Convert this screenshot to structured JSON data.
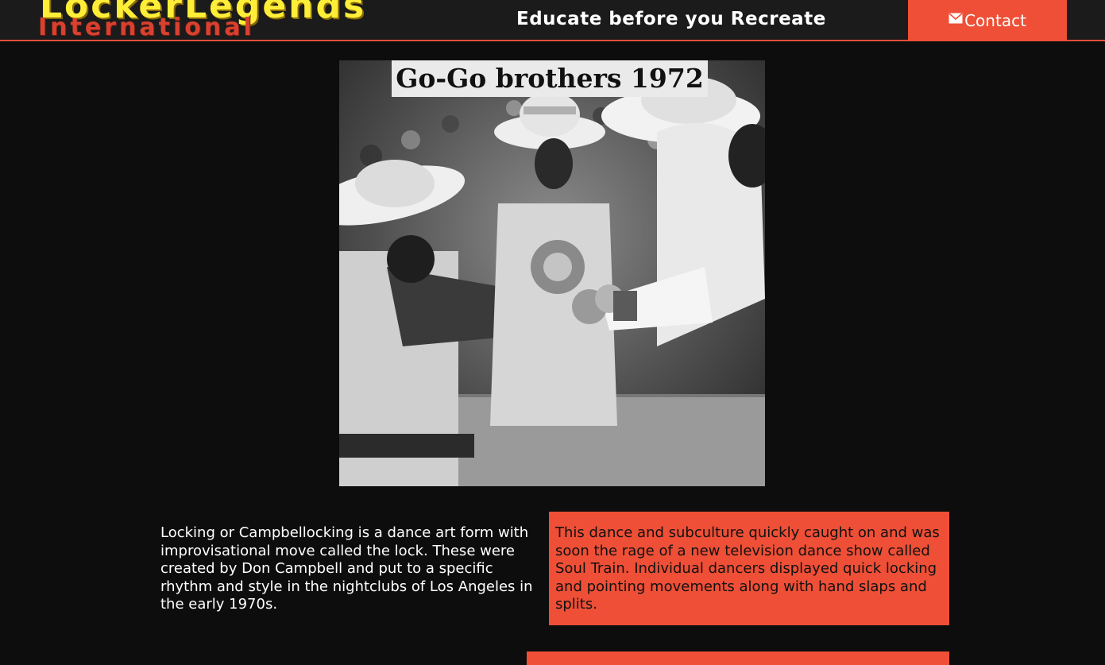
{
  "header": {
    "logo_main": "LockerLegends",
    "logo_sub": "International",
    "tagline": "Educate before you Recreate",
    "contact_label": "Contact",
    "contact_icon": "mail-icon"
  },
  "photo": {
    "caption": "Go-Go brothers 1972"
  },
  "content": {
    "left_paragraph": "Locking or Campbellocking is a dance art form with improvisational move called the lock. These were created by Don Campbell and put to a specific rhythm and style in the nightclubs of Los Angeles in the early 1970s.",
    "right_paragraph": "This dance and subculture quickly caught on and was soon the rage of a new television dance show called Soul Train. Individual dancers displayed quick locking and pointing movements along with hand slaps and splits."
  },
  "colors": {
    "accent": "#ee4f36",
    "logo_yellow": "#ffee38",
    "logo_red": "#d8412f",
    "background": "#0d0d0d",
    "header_bg": "#1b1b1b"
  }
}
